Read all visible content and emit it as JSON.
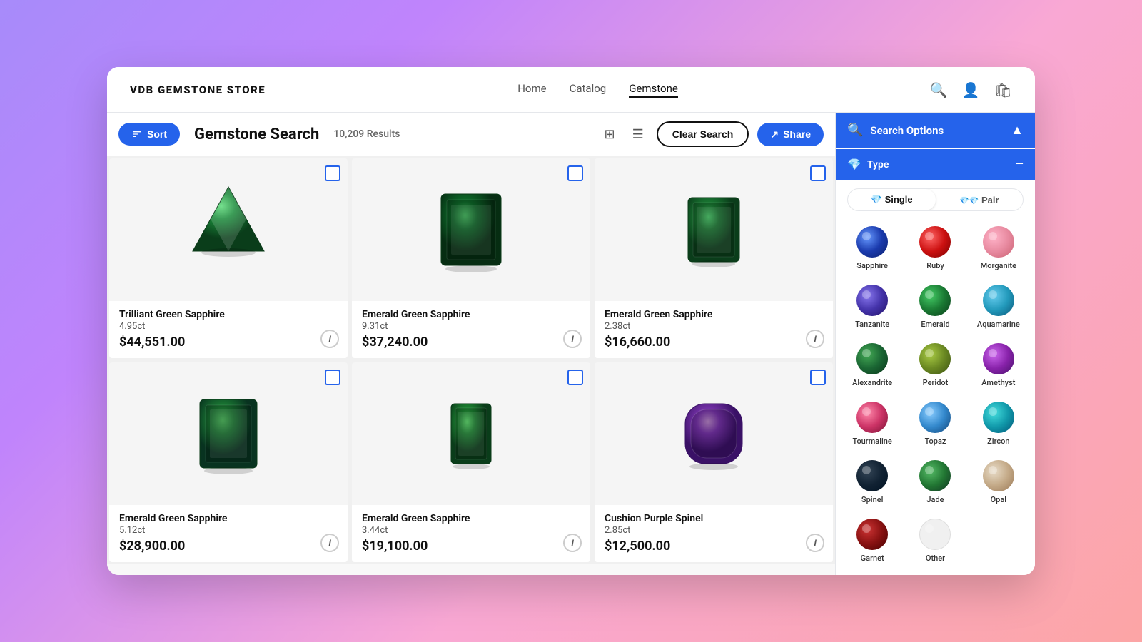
{
  "header": {
    "logo": "VDB GEMSTONE STORE",
    "nav": [
      {
        "label": "Home",
        "active": false
      },
      {
        "label": "Catalog",
        "active": false
      },
      {
        "label": "Gemstone",
        "active": true
      }
    ]
  },
  "toolbar": {
    "sort_label": "Sort",
    "search_title": "Gemstone Search",
    "results_count": "10,209 Results",
    "clear_search_label": "Clear Search",
    "share_label": "Share"
  },
  "products": [
    {
      "name": "Trilliant Green Sapphire",
      "weight": "4.95ct",
      "price": "$44,551.00",
      "shape": "pear"
    },
    {
      "name": "Emerald Green Sapphire",
      "weight": "9.31ct",
      "price": "$37,240.00",
      "shape": "emerald"
    },
    {
      "name": "Emerald Green Sapphire",
      "weight": "2.38ct",
      "price": "$16,660.00",
      "shape": "emerald2"
    },
    {
      "name": "Emerald Green Sapphire",
      "weight": "5.12ct",
      "price": "$28,900.00",
      "shape": "emerald3"
    },
    {
      "name": "Emerald Green Sapphire",
      "weight": "3.44ct",
      "price": "$19,100.00",
      "shape": "emerald4"
    },
    {
      "name": "Cushion Purple Spinel",
      "weight": "2.85ct",
      "price": "$12,500.00",
      "shape": "cushion"
    }
  ],
  "search_options": {
    "header_label": "Search Options",
    "type_label": "Type",
    "single_label": "Single",
    "pair_label": "Pair",
    "gem_types": [
      {
        "name": "Sapphire",
        "color_class": "gem-sapphire"
      },
      {
        "name": "Ruby",
        "color_class": "gem-ruby"
      },
      {
        "name": "Morganite",
        "color_class": "gem-morganite"
      },
      {
        "name": "Tanzanite",
        "color_class": "gem-tanzanite"
      },
      {
        "name": "Emerald",
        "color_class": "gem-emerald"
      },
      {
        "name": "Aquamarine",
        "color_class": "gem-aquamarine"
      },
      {
        "name": "Alexandrite",
        "color_class": "gem-alexandrite"
      },
      {
        "name": "Peridot",
        "color_class": "gem-peridot"
      },
      {
        "name": "Amethyst",
        "color_class": "gem-amethyst"
      },
      {
        "name": "Tourmaline",
        "color_class": "gem-tourmaline"
      },
      {
        "name": "Topaz",
        "color_class": "gem-topaz"
      },
      {
        "name": "Zircon",
        "color_class": "gem-zircon"
      },
      {
        "name": "Spinel",
        "color_class": "gem-spinel"
      },
      {
        "name": "Jade",
        "color_class": "gem-jade"
      },
      {
        "name": "Opal",
        "color_class": "gem-opal"
      },
      {
        "name": "Garnet",
        "color_class": "gem-garnet"
      },
      {
        "name": "Other",
        "color_class": "gem-other"
      }
    ]
  }
}
